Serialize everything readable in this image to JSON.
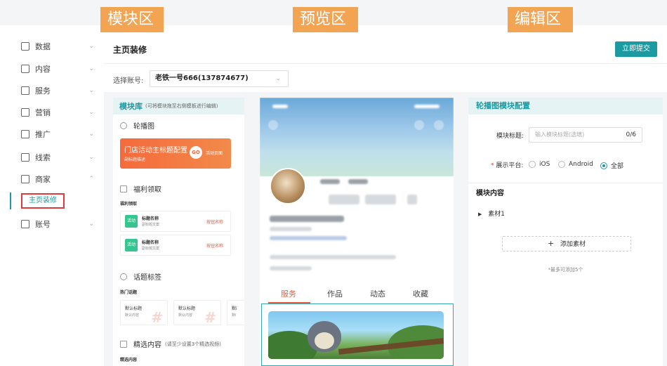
{
  "section_tags": {
    "modules": "模块区",
    "preview": "预览区",
    "editor": "编辑区"
  },
  "sidebar": {
    "items": [
      {
        "label": "数据",
        "icon": "data-icon",
        "chevron": "⌄"
      },
      {
        "label": "内容",
        "icon": "content-icon",
        "chevron": "⌄"
      },
      {
        "label": "服务",
        "icon": "service-icon",
        "chevron": "⌄"
      },
      {
        "label": "营销",
        "icon": "marketing-icon",
        "chevron": "⌄"
      },
      {
        "label": "推广",
        "icon": "promotion-icon",
        "chevron": "⌄"
      },
      {
        "label": "线索",
        "icon": "leads-icon",
        "chevron": "⌄"
      },
      {
        "label": "商家",
        "icon": "merchant-icon",
        "chevron": "⌃"
      },
      {
        "label": "账号",
        "icon": "account-icon",
        "chevron": "⌄"
      }
    ],
    "active_sub": "主页装修"
  },
  "header": {
    "title": "主页装修",
    "submit_label": "立即提交"
  },
  "account": {
    "label": "选择账号:",
    "value": "老铁一号666(137874677)"
  },
  "module_library": {
    "title": "模块库",
    "hint": "(可将模块拖至右侧模板进行编辑)",
    "carousel": {
      "label": "轮播图",
      "banner_main": "门店活动主标题配置",
      "banner_sub": "副标题描述",
      "go": "GO",
      "action": "活动页面"
    },
    "welfare": {
      "label": "福利领取",
      "header": "福利领取",
      "items": [
        {
          "badge": "活动",
          "title": "标题名称",
          "sub": "副标题文案",
          "button": "按钮名称"
        },
        {
          "badge": "活动",
          "title": "标题名称",
          "sub": "副标题文案",
          "button": "按钮名称"
        }
      ]
    },
    "topics": {
      "label": "话题标签",
      "header": "热门话题",
      "items": [
        {
          "title": "默认标题",
          "sub": "默认内容"
        },
        {
          "title": "默认标题",
          "sub": "默认内容"
        },
        {
          "title": "默i",
          "sub": "默i"
        }
      ]
    },
    "featured": {
      "label": "精选内容",
      "hint": "(请至少设置3个精选视频)",
      "header": "精选内容"
    }
  },
  "preview": {
    "tabs": [
      "服务",
      "作品",
      "动态",
      "收藏"
    ],
    "active_tab": "服务"
  },
  "editor": {
    "title": "轮播图模块配置",
    "module_title_label": "模块标题:",
    "module_title_placeholder": "输入模块标题(选填)",
    "module_title_count": "0/6",
    "platform_label": "展示平台:",
    "platforms": [
      "iOS",
      "Android",
      "全部"
    ],
    "selected_platform": "全部",
    "content_title": "模块内容",
    "material_item": "素材1",
    "add_button": "添加素材",
    "tip": "*最多可添加5个"
  },
  "colors": {
    "accent": "#1b9aa2",
    "tag": "#f3a452",
    "highlight_red": "#e0393e",
    "preview_tab_active": "#f05a3c"
  }
}
